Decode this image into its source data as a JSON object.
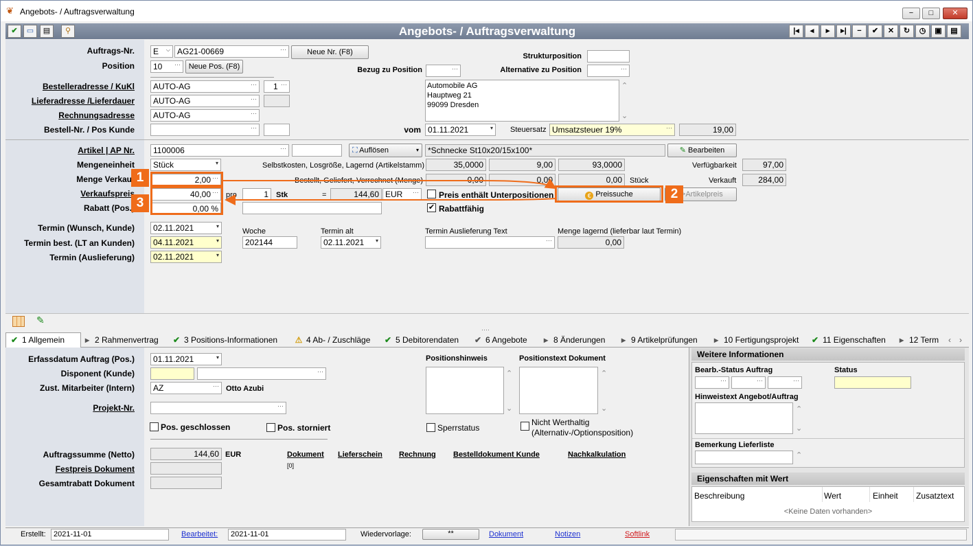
{
  "window": {
    "title": "Angebots- / Auftragsverwaltung",
    "min": "−",
    "max": "□",
    "close": "✕"
  },
  "toolbar": {
    "title": "Angebots- / Auftragsverwaltung",
    "nav": [
      "|◂",
      "◂",
      "▸",
      "▸|",
      "−",
      "✔",
      "✕",
      "↻",
      "◷",
      "▣",
      "▤"
    ]
  },
  "header": {
    "auftragsnr_label": "Auftrags-Nr.",
    "auftragsnr_prefix": "E",
    "auftragsnr": "AG21-00669",
    "neue_nr": "Neue Nr. (F8)",
    "position_label": "Position",
    "position": "10",
    "neue_pos": "Neue Pos. (F8)",
    "bezug_label": "Bezug zu Position",
    "struktur_label": "Strukturposition",
    "alternative_label": "Alternative zu Position",
    "besteller_label": "Bestelleradresse / KuKl",
    "besteller": "AUTO-AG",
    "besteller_num": "1",
    "liefer_label": "Lieferadresse /Lieferdauer",
    "liefer": "AUTO-AG",
    "rechnung_label": "Rechnungsadresse",
    "rechnung": "AUTO-AG",
    "bestellnr_label": "Bestell-Nr. / Pos Kunde",
    "address": [
      "Automobile AG",
      "Hauptweg 21",
      "99099 Dresden"
    ],
    "vom_label": "vom",
    "vom": "01.11.2021",
    "steuer_label": "Steuersatz",
    "steuer": "Umsatzsteuer 19%",
    "steuer_val": "19,00"
  },
  "artikel": {
    "artikel_label": "Artikel | AP Nr.",
    "artikel": "1100006",
    "aufloesen": "Auflösen",
    "beschreibung": "*Schnecke St10x20/15x100*",
    "bearbeiten": "Bearbeiten",
    "menge_einheit_label": "Mengeneinheit",
    "einheit": "Stück",
    "selbst_label": "Selbstkosten, Losgröße, Lagernd (Artikelstamm)",
    "selbst": [
      "35,0000",
      "9,00",
      "93,0000"
    ],
    "verfueg_label": "Verfügbarkeit",
    "verfueg": "97,00",
    "menge_label": "Menge Verkauf",
    "menge": "2,00",
    "bestellt_label": "Bestellt, Geliefert, Verrechnet (Menge)",
    "bestellt": [
      "0,00",
      "0,00",
      "0,00"
    ],
    "stueck": "Stück",
    "verkauft_label": "Verkauft",
    "verkauft": "284,00",
    "vkpreis_label": "Verkaufspreis",
    "vkpreis": "40,00",
    "pro_label": "pro",
    "pro": "1",
    "stk": "Stk",
    "eq": "=",
    "gesamt": "144,60",
    "waehrung": "EUR",
    "preis_unter_label": "Preis enthält Unterpositionen",
    "preissuche": "Preissuche",
    "artikelpreis": "->Artikelpreis",
    "rabatt_label": "Rabatt (Pos.)",
    "rabatt": "0,00 %",
    "rabattfaehig": "Rabattfähig",
    "termin_wunsch_label": "Termin (Wunsch, Kunde)",
    "termin_wunsch": "02.11.2021",
    "woche_label": "Woche",
    "woche": "202144",
    "termin_alt_label": "Termin alt",
    "termin_alt": "02.11.2021",
    "termin_ausl_text_label": "Termin Auslieferung Text",
    "menge_lagernd_label": "Menge lagernd (lieferbar laut Termin)",
    "menge_lagernd": "0,00",
    "termin_best_label": "Termin best. (LT an Kunden)",
    "termin_best": "04.11.2021",
    "termin_ausl_label": "Termin (Auslieferung)",
    "termin_ausl": "02.11.2021"
  },
  "callouts": [
    "1",
    "2",
    "3"
  ],
  "tabs": [
    {
      "icon": "✔",
      "label": "1 Allgemein"
    },
    {
      "icon": "▸",
      "label": "2 Rahmenvertrag"
    },
    {
      "icon": "✔",
      "label": "3 Positions-Informationen"
    },
    {
      "icon": "⚠",
      "label": "4 Ab- / Zuschläge"
    },
    {
      "icon": "✔",
      "label": "5 Debitorendaten"
    },
    {
      "icon": "✔",
      "label": "6 Angebote"
    },
    {
      "icon": "▸",
      "label": "8 Änderungen"
    },
    {
      "icon": "▸",
      "label": "9 Artikelprüfungen"
    },
    {
      "icon": "▸",
      "label": "10 Fertigungsprojekt"
    },
    {
      "icon": "✔",
      "label": "11 Eigenschaften"
    },
    {
      "icon": "▸",
      "label": "12 Term"
    }
  ],
  "allgemein": {
    "erfassung_label": "Erfassdatum Auftrag (Pos.)",
    "erfassung": "01.11.2021",
    "disponent_label": "Disponent (Kunde)",
    "mitarbeiter_label": "Zust. Mitarbeiter (Intern)",
    "mitarbeiter": "AZ",
    "mitarbeiter_name": "Otto Azubi",
    "projekt_label": "Projekt-Nr.",
    "pos_geschlossen": "Pos. geschlossen",
    "pos_storniert": "Pos. storniert",
    "positionshinweis": "Positionshinweis",
    "positionstext": "Positionstext Dokument",
    "sperrstatus": "Sperrstatus",
    "nicht_wert": "Nicht Werthaltig",
    "nicht_wert2": "(Alternativ-/Optionsposition)",
    "summe_label": "Auftragssumme (Netto)",
    "summe": "144,60",
    "summe_cur": "EUR",
    "festpreis_label": "Festpreis Dokument",
    "gesamtrabatt_label": "Gesamtrabatt Dokument",
    "links": [
      "Dokument",
      "Lieferschein",
      "Rechnung",
      "Bestelldokument Kunde",
      "Nachkalkulation"
    ],
    "dok_count": "[0]"
  },
  "weitere": {
    "header": "Weitere Informationen",
    "bearb_label": "Bearb.-Status Auftrag",
    "status_label": "Status",
    "hinweis_label": "Hinweistext Angebot/Auftrag",
    "bemerkung_label": "Bemerkung Lieferliste"
  },
  "eigenschaften": {
    "header": "Eigenschaften mit Wert",
    "cols": [
      "Beschreibung",
      "Wert",
      "Einheit",
      "Zusatztext"
    ],
    "empty": "<Keine Daten vorhanden>"
  },
  "status": {
    "erstellt_label": "Erstellt:",
    "erstellt": "2021-11-01",
    "bearbeitet_label": "Bearbeitet:",
    "bearbeitet": "2021-11-01",
    "wiedervorlage_label": "Wiedervorlage:",
    "wiedervorlage": "**",
    "dokument": "Dokument",
    "notizen": "Notizen",
    "softlink": "Softlink"
  },
  "colors": {
    "accent": "#ef6c1a",
    "toolbar": "#7d8aa0",
    "link": "#1c2fd0",
    "softlink": "#d0181c"
  }
}
